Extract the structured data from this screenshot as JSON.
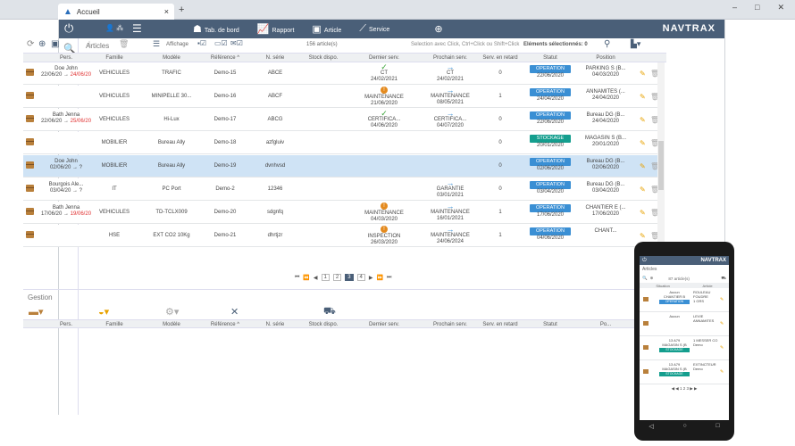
{
  "browser": {
    "tab_title": "Accueil",
    "close": "×",
    "new_tab": "+",
    "minimize": "–",
    "maximize": "□",
    "close_window": "✕"
  },
  "topbar": {
    "nav": [
      {
        "label": "Tab. de bord",
        "icon": "users-icon"
      },
      {
        "label": "Rapport",
        "icon": "chart-icon"
      },
      {
        "label": "Article",
        "icon": "article-icon"
      },
      {
        "label": "Service",
        "icon": "tools-icon"
      }
    ],
    "brand": "NAVTRAX"
  },
  "articles": {
    "title": "Articles",
    "toolbar": {
      "affichage": "Affichage",
      "count": "156 article(s)",
      "hint": "Selection avec Click, Ctrl+Click ou Shift+Click",
      "selected": "Eléments sélectionnés: 0"
    },
    "columns": [
      "Pers.",
      "Famille",
      "Modèle",
      "Référence ^",
      "N. série",
      "Stock dispo.",
      "Dernier serv.",
      "Prochain serv.",
      "Serv. en retard",
      "Statut",
      "Position"
    ],
    "rows": [
      {
        "pers": "Doe John",
        "date_from": "22/06/20",
        "date_to": "24/06/20",
        "to_red": true,
        "famille": "VEHICULES",
        "modele": "TRAFIC",
        "ref": "Demo-15",
        "serie": "ABCE",
        "last_icon": "check",
        "last": "CT",
        "last_date": "24/02/2021",
        "next": "CT",
        "next_date": "24/02/2021",
        "retard": "0",
        "statut": "OPERATION",
        "statut_type": "op",
        "statut_date": "22/06/2020",
        "position": "PARKING S (B...",
        "position_date": "04/03/2020"
      },
      {
        "pers": "",
        "date_from": "",
        "date_to": "",
        "to_red": false,
        "famille": "VEHICULES",
        "modele": "MINIPELLE 30...",
        "ref": "Demo-16",
        "serie": "ABCF",
        "last_icon": "warn",
        "last": "MAINTENANCE",
        "last_date": "21/06/2020",
        "next": "MAINTENANCE",
        "next_date": "08/05/2021",
        "retard": "1",
        "statut": "OPERATION",
        "statut_type": "op",
        "statut_date": "24/04/2020",
        "position": "ANNAMITES (...",
        "position_date": "24/04/2020"
      },
      {
        "pers": "Bath Jenna",
        "date_from": "22/06/20",
        "date_to": "25/06/20",
        "to_red": true,
        "famille": "VEHICULES",
        "modele": "Hi-Lux",
        "ref": "Demo-17",
        "serie": "ABCG",
        "last_icon": "check",
        "last": "CERTIFICA...",
        "last_date": "04/06/2020",
        "next": "CERTIFICA...",
        "next_date": "04/07/2020",
        "retard": "0",
        "statut": "OPERATION",
        "statut_type": "op",
        "statut_date": "22/06/2020",
        "position": "Bureau DG (B...",
        "position_date": "24/04/2020"
      },
      {
        "pers": "",
        "date_from": "",
        "date_to": "",
        "to_red": false,
        "famille": "MOBILIER",
        "modele": "Bureau Ally",
        "ref": "Demo-18",
        "serie": "azfgluiv",
        "last_icon": "",
        "last": "",
        "last_date": "",
        "next": "",
        "next_date": "",
        "retard": "0",
        "statut": "STOCKAGE",
        "statut_type": "st",
        "statut_date": "20/01/2020",
        "position": "MAGASIN S (B...",
        "position_date": "20/01/2020"
      },
      {
        "pers": "Doe John",
        "date_from": "02/06/20",
        "date_to": "?",
        "to_red": false,
        "famille": "MOBILIER",
        "modele": "Bureau Ally",
        "ref": "Demo-19",
        "serie": "dvnhvsd",
        "last_icon": "",
        "last": "",
        "last_date": "",
        "next": "",
        "next_date": "",
        "retard": "0",
        "statut": "OPERATION",
        "statut_type": "op",
        "statut_date": "02/06/2020",
        "position": "Bureau DG (B...",
        "position_date": "02/06/2020",
        "selected": true
      },
      {
        "pers": "Bourgois Ale...",
        "date_from": "03/04/20",
        "date_to": "?",
        "to_red": false,
        "famille": "IT",
        "modele": "PC Port",
        "ref": "Demo-2",
        "serie": "12346",
        "last_icon": "",
        "last": "",
        "last_date": "",
        "next": "GARANTIE",
        "next_date": "03/01/2021",
        "retard": "0",
        "statut": "OPERATION",
        "statut_type": "op",
        "statut_date": "03/04/2020",
        "position": "Bureau DG (B...",
        "position_date": "03/04/2020"
      },
      {
        "pers": "Bath Jenna",
        "date_from": "17/06/20",
        "date_to": "19/06/20",
        "to_red": true,
        "famille": "VEHICULES",
        "modele": "TD-TCLX009",
        "ref": "Demo-20",
        "serie": "sdgnfq",
        "last_icon": "warn",
        "last": "MAINTENANCE",
        "last_date": "04/03/2020",
        "next": "MAINTENANCE",
        "next_date": "16/01/2021",
        "retard": "1",
        "statut": "OPERATION",
        "statut_type": "op",
        "statut_date": "17/06/2020",
        "position": "CHANTIER E (...",
        "position_date": "17/06/2020"
      },
      {
        "pers": "",
        "date_from": "",
        "date_to": "",
        "to_red": false,
        "famille": "HSE",
        "modele": "EXT CO2 10Kg",
        "ref": "Demo-21",
        "serie": "dhrtjzr",
        "last_icon": "warn",
        "last": "INSPECTION",
        "last_date": "26/03/2020",
        "next": "MAINTENANCE",
        "next_date": "24/06/2024",
        "retard": "1",
        "statut": "OPERATION",
        "statut_type": "op",
        "statut_date": "04/06/2020",
        "position": "CHANT...",
        "position_date": ""
      }
    ],
    "pager": {
      "first": "⏮",
      "prev2": "⏪",
      "prev": "◀",
      "pages": [
        "1",
        "2",
        "3",
        "4"
      ],
      "current": "3",
      "next": "▶",
      "next2": "⏩",
      "last": "⏭"
    }
  },
  "gestion": {
    "title": "Gestion",
    "columns": [
      "Pers.",
      "Famille",
      "Modèle",
      "Référence ^",
      "N. série",
      "Stock dispo.",
      "Dernier serv.",
      "Prochain serv.",
      "Serv. en retard",
      "Statut",
      "Po..."
    ]
  },
  "phone": {
    "brand": "NAVTRAX",
    "title": "Articles",
    "count": "87 article(s)",
    "cols": [
      "Situation",
      "Article"
    ],
    "rows": [
      {
        "a": "Aucun",
        "b": "CHANTIER B",
        "badge": "OPERATION",
        "badge_type": "op",
        "c": "ROULEAU FOUDRE",
        "d": "1 GRS"
      },
      {
        "a": "Aucun",
        "b": "",
        "badge": "",
        "badge_type": "op",
        "c": "LEVIE",
        "d": "ANNAMITES"
      },
      {
        "a": "13 A79",
        "b": "MAGASIN S (B",
        "badge": "STOCKAGE",
        "badge_type": "st",
        "c": "1 MESSER CO",
        "d": "Demo"
      },
      {
        "a": "13 A79",
        "b": "MAGASIN S (B",
        "badge": "STOCKAGE",
        "badge_type": "st",
        "c": "EXTINCTEUR",
        "d": "Demo"
      }
    ],
    "pager": "◀ ◀ 1 2 3 ▶ ▶"
  }
}
